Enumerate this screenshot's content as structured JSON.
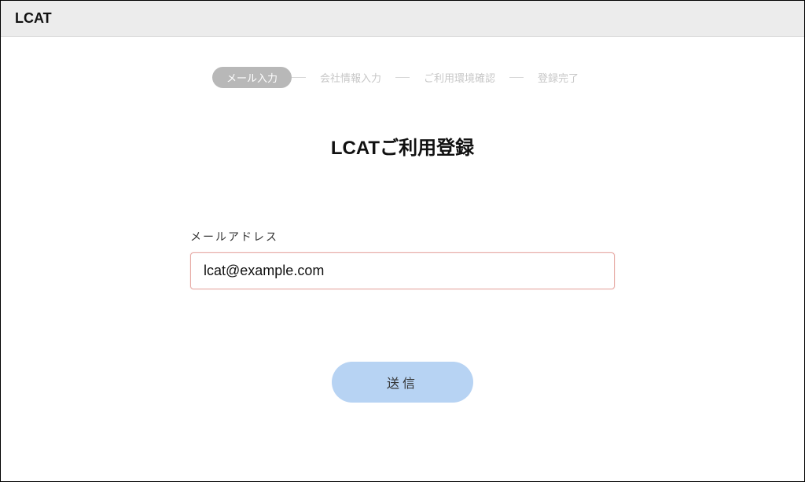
{
  "header": {
    "title": "LCAT"
  },
  "stepper": {
    "steps": [
      {
        "label": "メール入力",
        "active": true
      },
      {
        "label": "会社情報入力",
        "active": false
      },
      {
        "label": "ご利用環境確認",
        "active": false
      },
      {
        "label": "登録完了",
        "active": false
      }
    ]
  },
  "page": {
    "title": "LCATご利用登録"
  },
  "form": {
    "email_label": "メールアドレス",
    "email_value": "lcat@example.com",
    "submit_label": "送信"
  }
}
